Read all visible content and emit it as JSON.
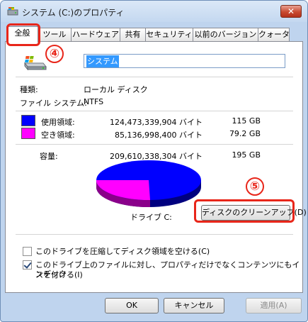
{
  "window": {
    "title": "システム (C:)のプロパティ",
    "close_glyph": "✕"
  },
  "tabs": [
    {
      "label": "全般",
      "active": true
    },
    {
      "label": "ツール"
    },
    {
      "label": "ハードウェア"
    },
    {
      "label": "共有"
    },
    {
      "label": "セキュリティ"
    },
    {
      "label": "以前のバージョン"
    },
    {
      "label": "クォータ"
    }
  ],
  "general": {
    "name_value": "システム",
    "type_label": "種類:",
    "type_value": "ローカル ディスク",
    "fs_label": "ファイル システム:",
    "fs_value": "NTFS",
    "used": {
      "label": "使用領域:",
      "bytes": "124,473,339,904 バイト",
      "gb": "115 GB",
      "color": "#0000ff"
    },
    "free": {
      "label": "空き領域:",
      "bytes": "85,136,998,400 バイト",
      "gb": "79.2 GB",
      "color": "#ff00ff"
    },
    "capacity": {
      "label": "容量:",
      "bytes": "209,610,338,304 バイト",
      "gb": "195 GB"
    },
    "drive_label": "ドライブ C:",
    "cleanup_button": "ディスクのクリーンアップ(D)",
    "compress_checkbox": {
      "label": "このドライブを圧縮してディスク領域を空ける(C)",
      "checked": false
    },
    "index_checkbox": {
      "line1": "このドライブ上のファイルに対し、プロパティだけでなくコンテンツにもインデック",
      "line2": "スを付ける(I)",
      "checked": true
    },
    "used_fraction": 0.594
  },
  "footer": {
    "ok": "OK",
    "cancel": "キャンセル",
    "apply": "適用(A)"
  },
  "annotations": {
    "n4": "④",
    "n5": "⑤",
    "color": "#e8261a"
  }
}
